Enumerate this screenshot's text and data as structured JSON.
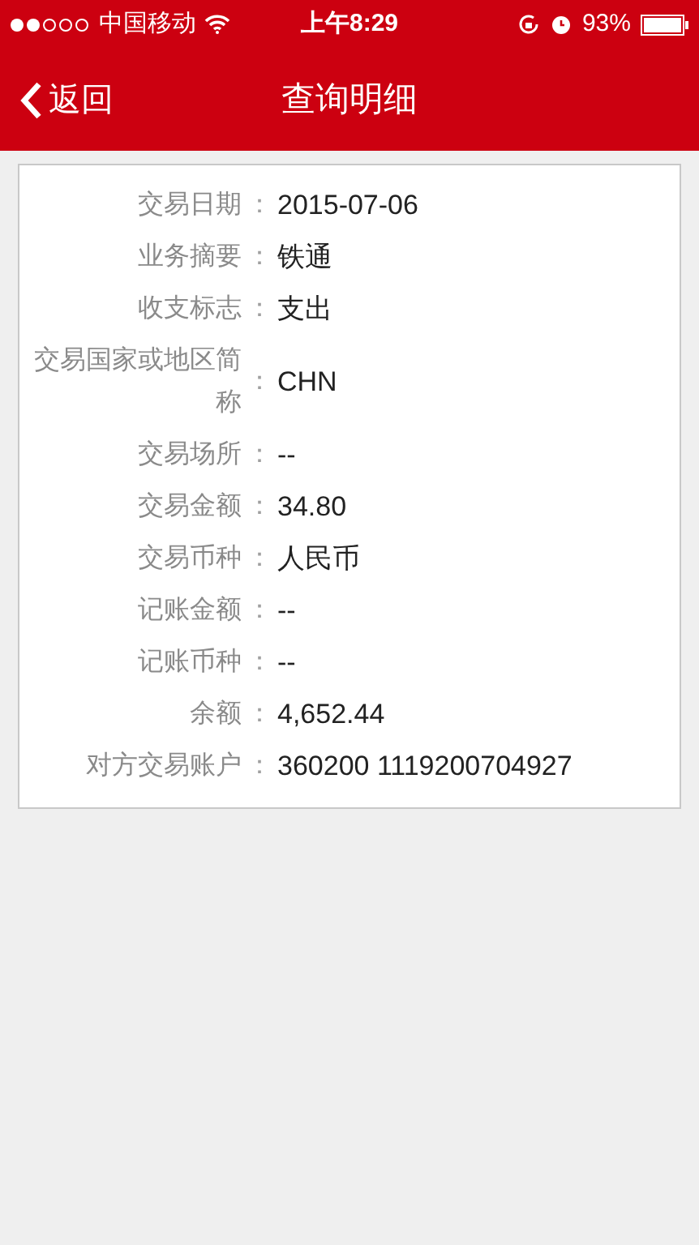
{
  "status_bar": {
    "carrier": "中国移动",
    "time": "上午8:29",
    "battery": "93%"
  },
  "nav": {
    "back": "返回",
    "title": "查询明细"
  },
  "details": [
    {
      "label": "交易日期",
      "separator": "：",
      "value": "2015-07-06"
    },
    {
      "label": "业务摘要",
      "separator": "：",
      "value": "铁通"
    },
    {
      "label": "收支标志",
      "separator": "：",
      "value": "支出"
    },
    {
      "label": "交易国家或地区简称",
      "separator": "：",
      "value": "CHN"
    },
    {
      "label": "交易场所",
      "separator": "：",
      "value": "--"
    },
    {
      "label": "交易金额",
      "separator": "：",
      "value": "34.80"
    },
    {
      "label": "交易币种",
      "separator": "：",
      "value": "人民币"
    },
    {
      "label": "记账金额",
      "separator": "：",
      "value": "--"
    },
    {
      "label": "记账币种",
      "separator": "：",
      "value": "--"
    },
    {
      "label": "余额",
      "separator": "：",
      "value": "4,652.44"
    },
    {
      "label": "对方交易账户",
      "separator": "：",
      "value": "360200 1119200704927"
    }
  ]
}
